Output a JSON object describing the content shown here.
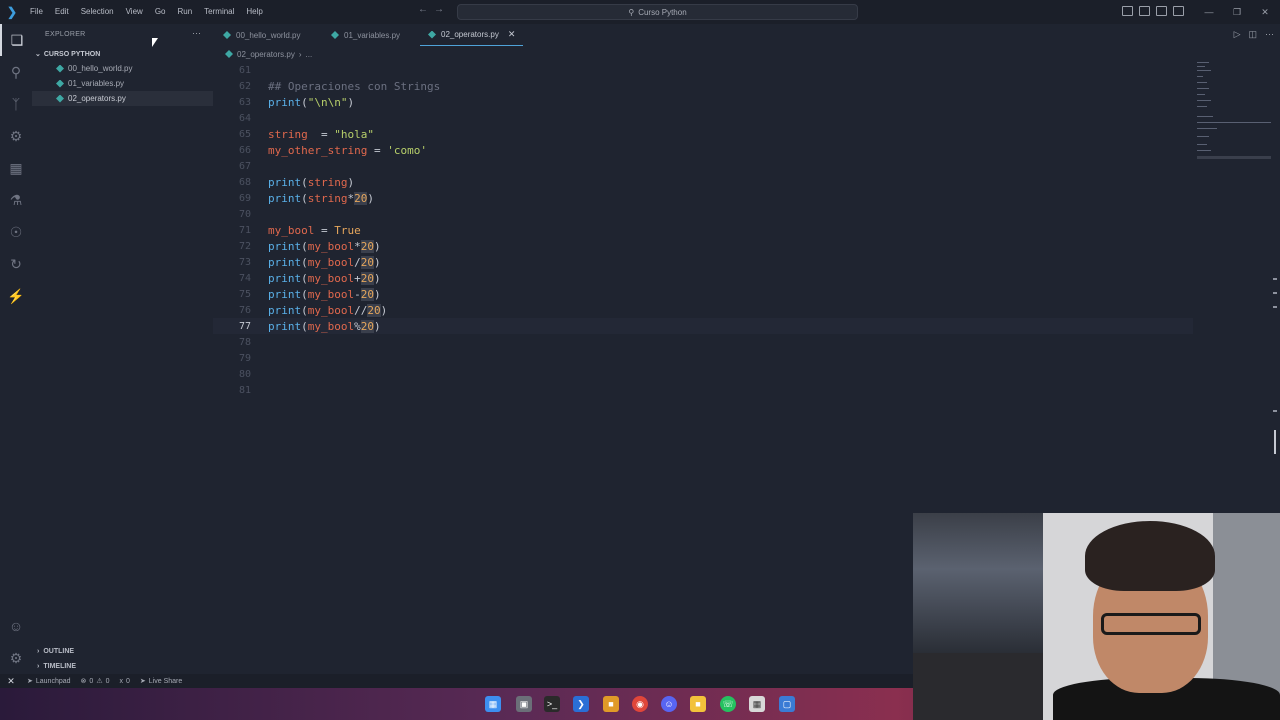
{
  "titlebar": {
    "menu": [
      "File",
      "Edit",
      "Selection",
      "View",
      "Go",
      "Run",
      "Terminal",
      "Help"
    ],
    "search_text": "Curso Python"
  },
  "sidebar": {
    "title": "EXPLORER",
    "folder": "CURSO PYTHON",
    "files": [
      "00_hello_world.py",
      "01_variables.py",
      "02_operators.py"
    ],
    "outline_label": "OUTLINE",
    "timeline_label": "TIMELINE"
  },
  "tabs": [
    {
      "label": "00_hello_world.py"
    },
    {
      "label": "01_variables.py"
    },
    {
      "label": "02_operators.py"
    }
  ],
  "breadcrumb": {
    "file": "02_operators.py",
    "rest": "..."
  },
  "editor": {
    "current_line": 77,
    "lines": [
      {
        "n": "61",
        "text": ""
      },
      {
        "n": "62",
        "text": "## Operaciones con Strings"
      },
      {
        "n": "63",
        "text": "print(\"\\n\\n\")"
      },
      {
        "n": "64",
        "text": ""
      },
      {
        "n": "65",
        "text": "string  = \"hola\""
      },
      {
        "n": "66",
        "text": "my_other_string = 'como'"
      },
      {
        "n": "67",
        "text": ""
      },
      {
        "n": "68",
        "text": "print(string)"
      },
      {
        "n": "69",
        "text": "print(string*20)"
      },
      {
        "n": "70",
        "text": ""
      },
      {
        "n": "71",
        "text": "my_bool = True"
      },
      {
        "n": "72",
        "text": "print(my_bool*20)"
      },
      {
        "n": "73",
        "text": "print(my_bool/20)"
      },
      {
        "n": "74",
        "text": "print(my_bool+20)"
      },
      {
        "n": "75",
        "text": "print(my_bool-20)"
      },
      {
        "n": "76",
        "text": "print(my_bool//20)"
      },
      {
        "n": "77",
        "text": "print(my_bool%20)"
      },
      {
        "n": "78",
        "text": ""
      },
      {
        "n": "79",
        "text": ""
      },
      {
        "n": "80",
        "text": ""
      },
      {
        "n": "81",
        "text": ""
      }
    ]
  },
  "statusbar": {
    "launchpad": "Launchpad",
    "errors": "0",
    "warnings": "0",
    "ports": "0",
    "live_share": "Live Share"
  }
}
